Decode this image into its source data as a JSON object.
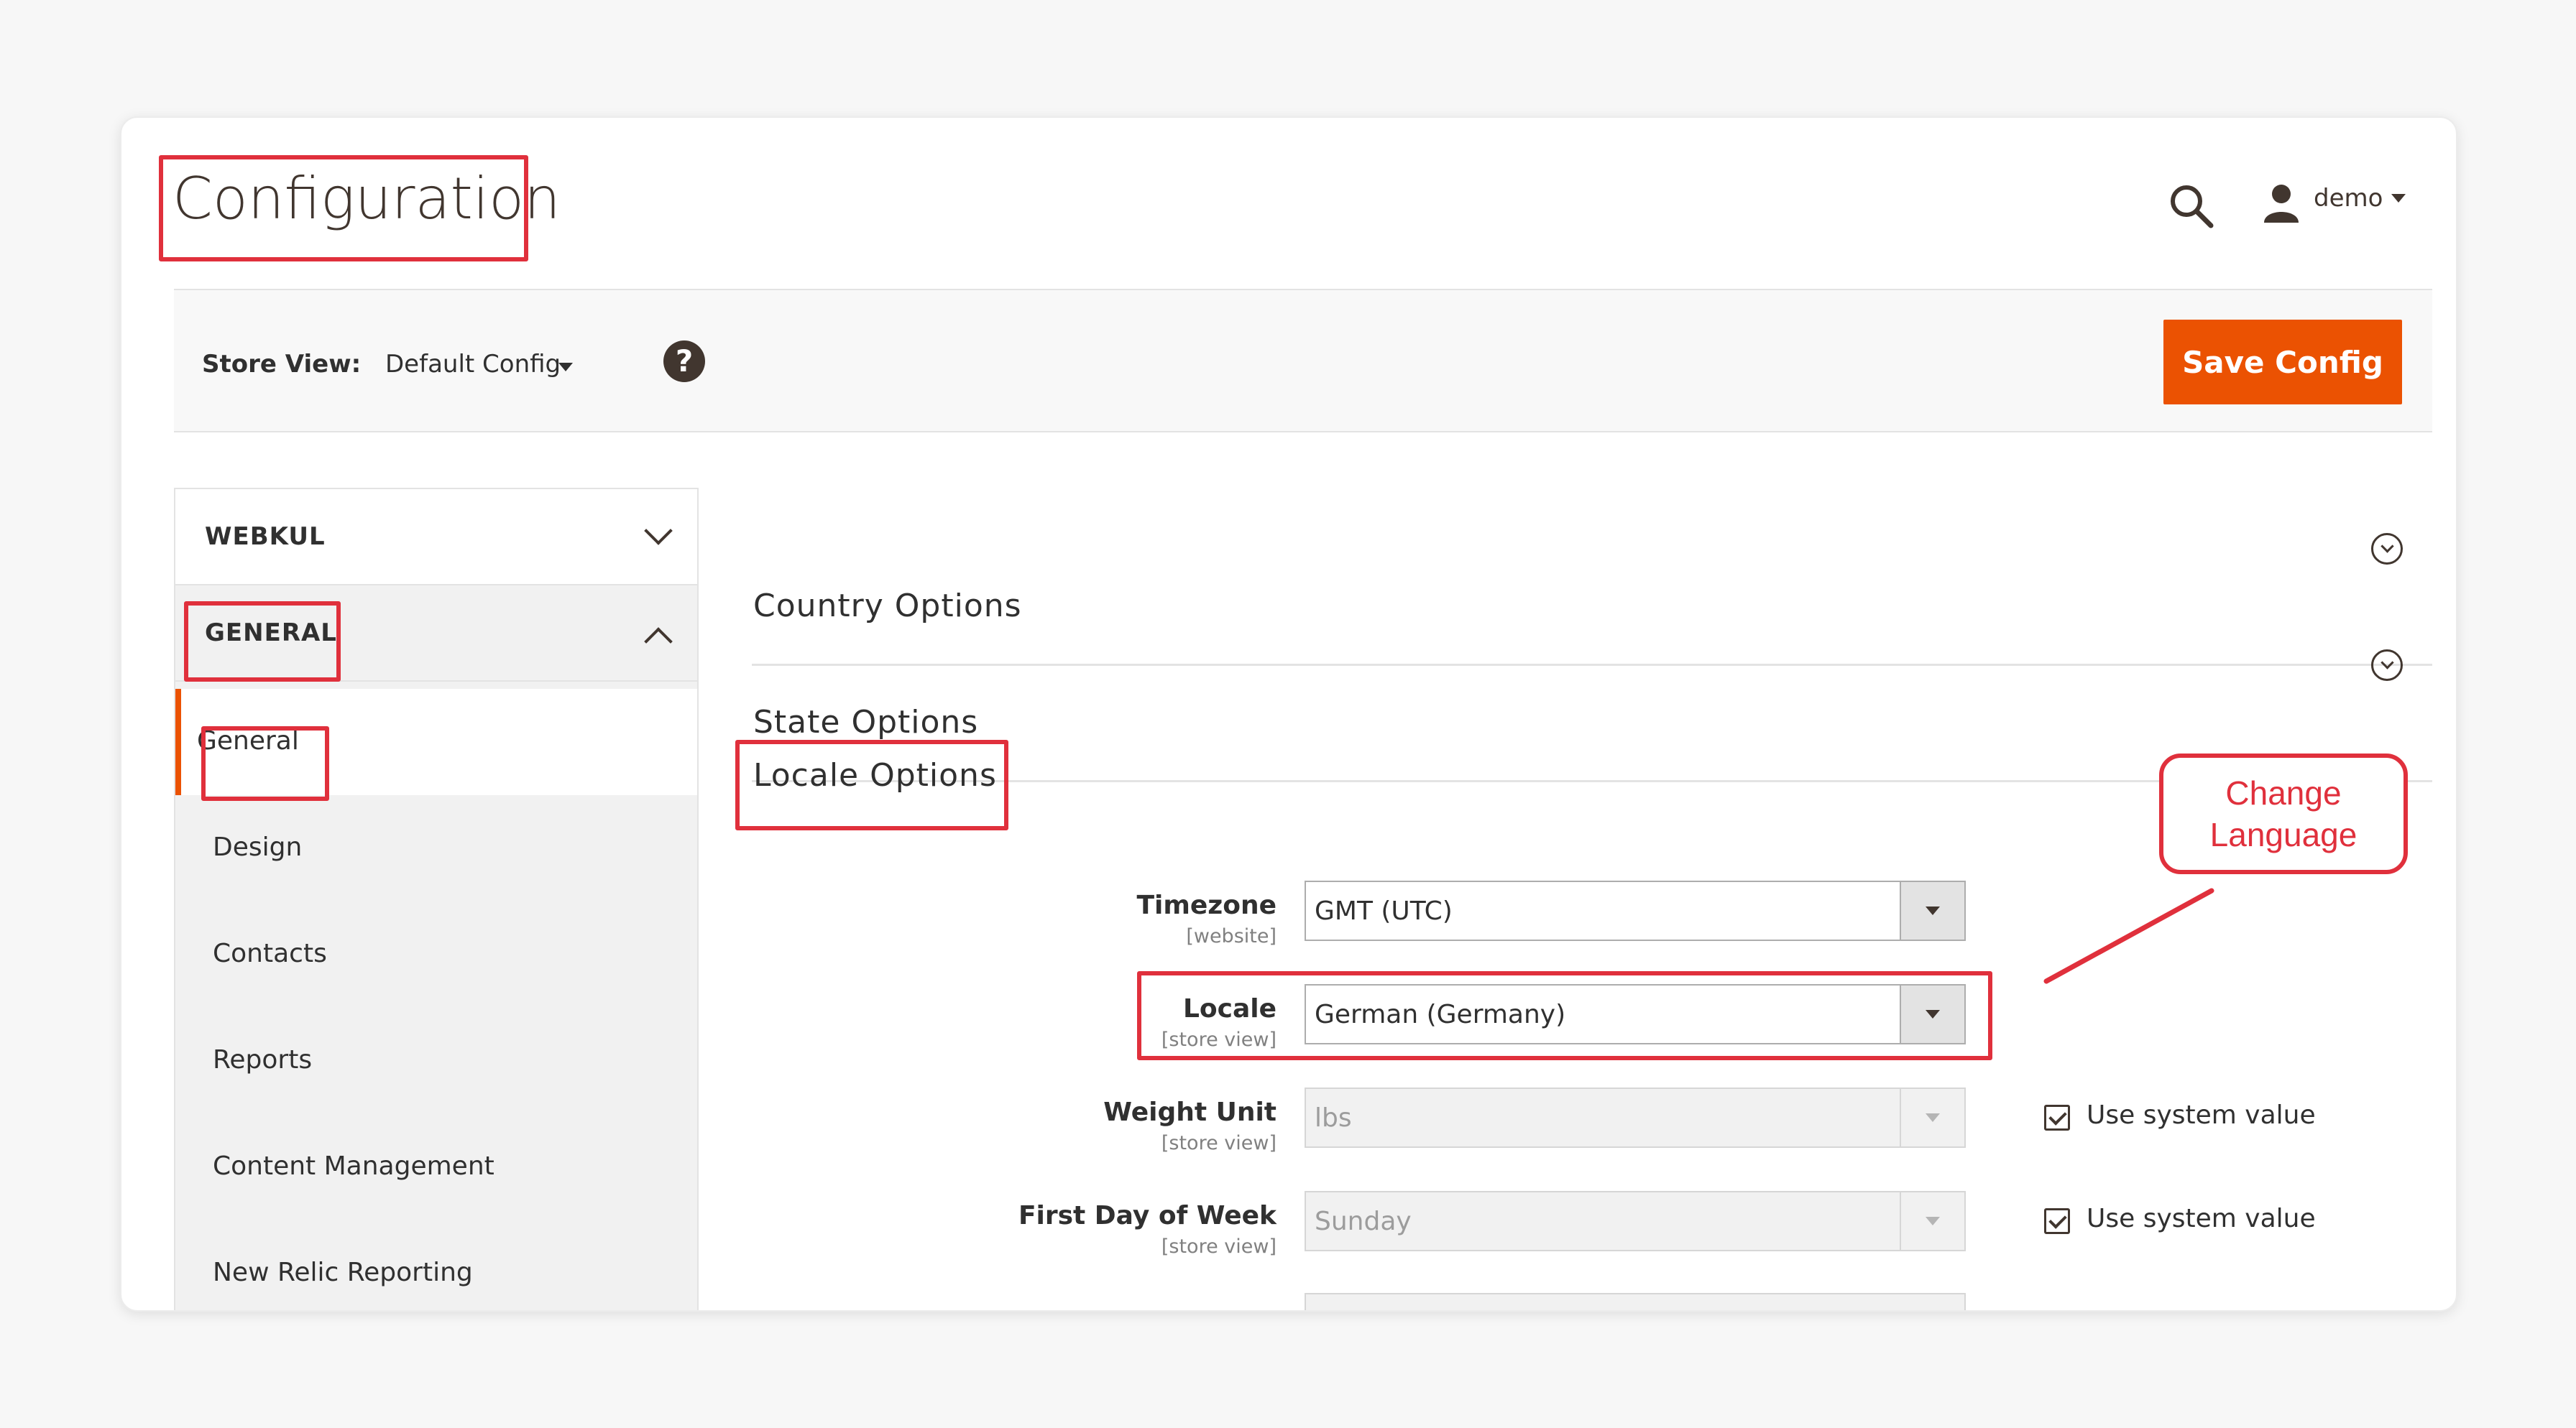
{
  "header": {
    "page_title": "Configuration",
    "user_name": "demo"
  },
  "store_view": {
    "label": "Store View:",
    "value": "Default Config",
    "help": "?"
  },
  "actions": {
    "save_label": "Save Config"
  },
  "sidebar": {
    "groups": [
      {
        "label": "WEBKUL",
        "expanded": false
      },
      {
        "label": "GENERAL",
        "expanded": true
      }
    ],
    "items": [
      {
        "label": "General",
        "current": true
      },
      {
        "label": "Design"
      },
      {
        "label": "Contacts"
      },
      {
        "label": "Reports"
      },
      {
        "label": "Content Management"
      },
      {
        "label": "New Relic Reporting"
      }
    ]
  },
  "sections": [
    {
      "title": "Country Options"
    },
    {
      "title": "State Options"
    },
    {
      "title": "Locale Options"
    }
  ],
  "locale_fields": [
    {
      "label": "Timezone",
      "scope": "[website]",
      "value": "GMT (UTC)",
      "disabled": false
    },
    {
      "label": "Locale",
      "scope": "[store view]",
      "value": "German (Germany)",
      "disabled": false
    },
    {
      "label": "Weight Unit",
      "scope": "[store view]",
      "value": "lbs",
      "disabled": true,
      "use_system_value": true,
      "system_label": "Use system value"
    },
    {
      "label": "First Day of Week",
      "scope": "[store view]",
      "value": "Sunday",
      "disabled": true,
      "use_system_value": true,
      "system_label": "Use system value"
    }
  ],
  "annotation": {
    "line1": "Change",
    "line2": "Language"
  },
  "colors": {
    "accent": "#eb5202",
    "highlight": "#e0303c"
  }
}
